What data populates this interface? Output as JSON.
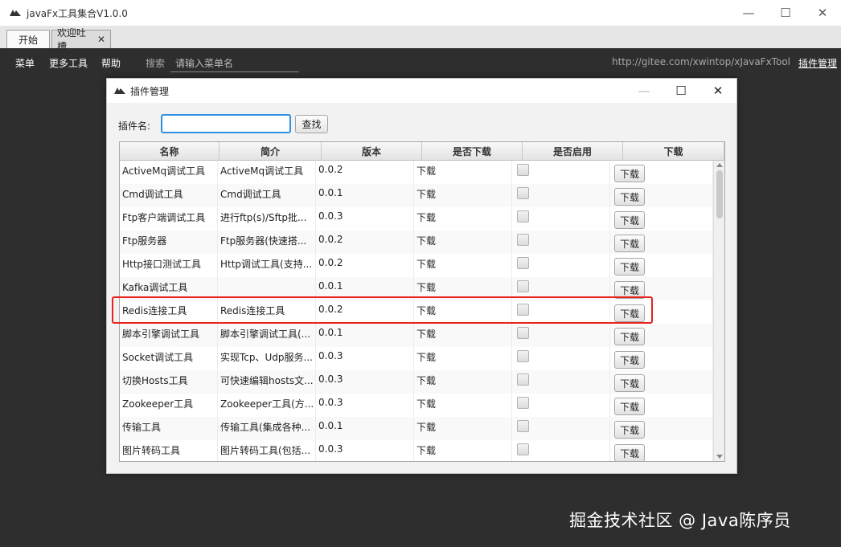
{
  "window": {
    "title": "javaFx工具集合V1.0.0",
    "minimize_symbol": "—",
    "maximize_symbol": "☐",
    "close_symbol": "✕"
  },
  "tabs": [
    {
      "label": "开始"
    },
    {
      "label": "欢迎吐槽",
      "close_symbol": "✕"
    }
  ],
  "menubar": {
    "items": [
      "菜单",
      "更多工具",
      "帮助"
    ],
    "search_label": "搜索",
    "search_placeholder": "请输入菜单名",
    "url_text": "http://gitee.com/xwintop/xJavaFxTool",
    "plugin_link": "插件管理"
  },
  "dialog": {
    "title": "插件管理",
    "name_label": "插件名:",
    "name_value": "",
    "find_button": "查找",
    "columns": [
      "名称",
      "简介",
      "版本",
      "是否下载",
      "是否启用",
      "下载"
    ],
    "download_button": "下载",
    "rows": [
      {
        "name": "ActiveMq调试工具",
        "desc": "ActiveMq调试工具",
        "version": "0.0.2",
        "downloaded": "下载",
        "enabled": false
      },
      {
        "name": "Cmd调试工具",
        "desc": "Cmd调试工具",
        "version": "0.0.1",
        "downloaded": "下载",
        "enabled": false
      },
      {
        "name": "Ftp客户端调试工具",
        "desc": "进行ftp(s)/Sftp批...",
        "version": "0.0.3",
        "downloaded": "下载",
        "enabled": false
      },
      {
        "name": "Ftp服务器",
        "desc": "Ftp服务器(快速搭...",
        "version": "0.0.2",
        "downloaded": "下载",
        "enabled": false
      },
      {
        "name": "Http接口测试工具",
        "desc": "Http调试工具(支持...",
        "version": "0.0.2",
        "downloaded": "下载",
        "enabled": false
      },
      {
        "name": "Kafka调试工具",
        "desc": "",
        "version": "0.0.1",
        "downloaded": "下载",
        "enabled": false
      },
      {
        "name": "Redis连接工具",
        "desc": "Redis连接工具",
        "version": "0.0.2",
        "downloaded": "下载",
        "enabled": false
      },
      {
        "name": "脚本引擎调试工具",
        "desc": "脚本引擎调试工具(...",
        "version": "0.0.1",
        "downloaded": "下载",
        "enabled": false
      },
      {
        "name": "Socket调试工具",
        "desc": "实现Tcp、Udp服务...",
        "version": "0.0.3",
        "downloaded": "下载",
        "enabled": false
      },
      {
        "name": "切换Hosts工具",
        "desc": "可快速编辑hosts文...",
        "version": "0.0.3",
        "downloaded": "下载",
        "enabled": false
      },
      {
        "name": "Zookeeper工具",
        "desc": "Zookeeper工具(方...",
        "version": "0.0.3",
        "downloaded": "下载",
        "enabled": false
      },
      {
        "name": "传输工具",
        "desc": "传输工具(集成各种...",
        "version": "0.0.1",
        "downloaded": "下载",
        "enabled": false
      },
      {
        "name": "图片转码工具",
        "desc": "图片转码工具(包括...",
        "version": "0.0.3",
        "downloaded": "下载",
        "enabled": false
      }
    ]
  },
  "watermark": "掘金技术社区 @ Java陈序员",
  "colors": {
    "content_bg": "#2e2e2e",
    "highlight_border": "#e8231c",
    "input_focus": "#2d8fe0"
  }
}
